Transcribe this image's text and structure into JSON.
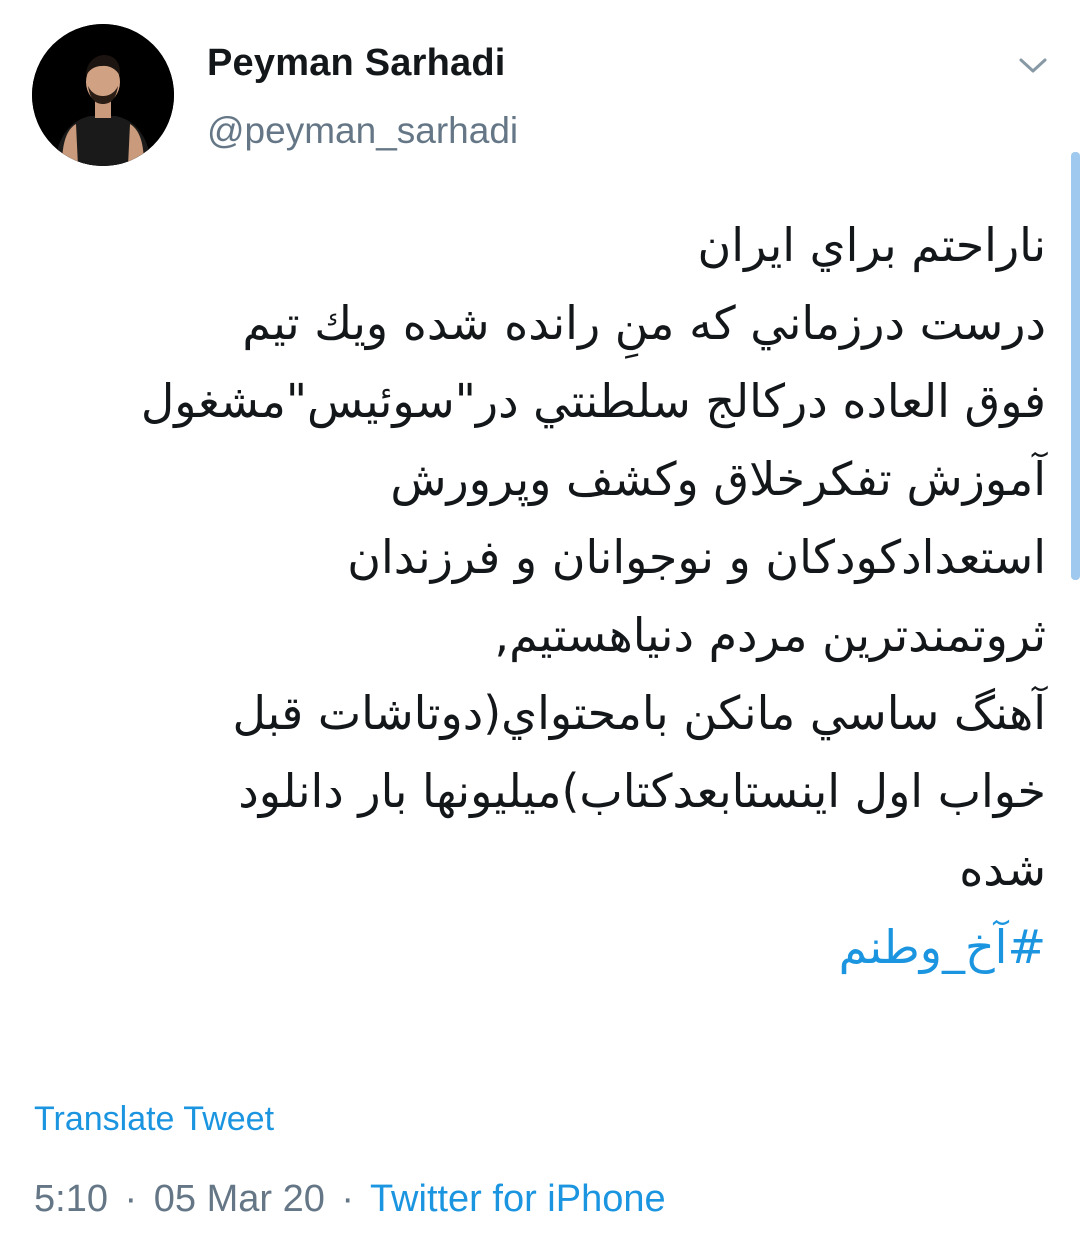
{
  "author": {
    "display_name": "Peyman Sarhadi",
    "handle": "@peyman_sarhadi",
    "avatar_icon": "profile-photo"
  },
  "menu_icon": "chevron-down-icon",
  "tweet": {
    "lines": [
      "ناراحتم براي ايران",
      "درست درزماني كه منِ رانده شده ويك تيم",
      "فوق العاده دركالج سلطنتي در\"سوئيس\"مشغول",
      "آموزش تفكرخلاق وكشف وپرورش",
      "استعدادكودكان و نوجوانان و فرزندان",
      "ثروتمندترين مردم دنياهستيم,",
      "آهنگ ساسي مانكن بامحتواي(دوتاشات قبل",
      "خواب اول اينستابعدكتاب)ميليونها بار دانلود",
      "شده"
    ],
    "hashtag": "#آخ_وطنم"
  },
  "translate_label": "Translate Tweet",
  "meta": {
    "time": "5:10",
    "date": "05 Mar 20",
    "separator": "·",
    "source": "Twitter for iPhone"
  },
  "colors": {
    "link": "#1b95e0",
    "text": "#14171a",
    "secondary": "#657786",
    "scrollbar": "#9fc9ee"
  }
}
